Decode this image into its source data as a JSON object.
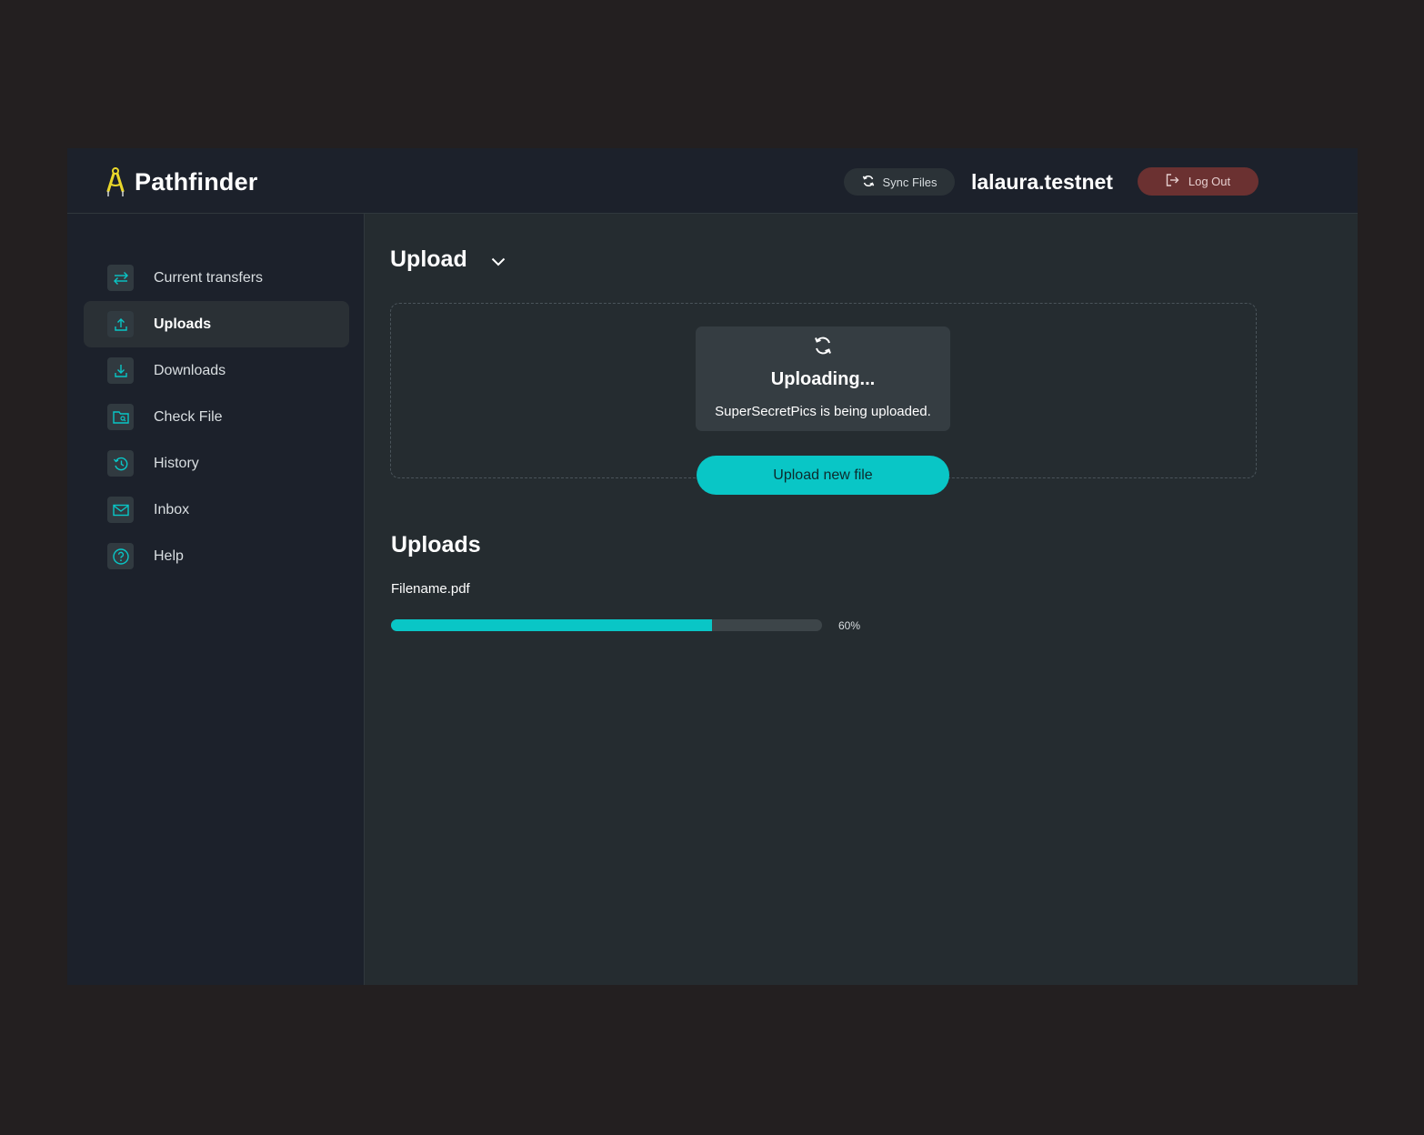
{
  "brand": {
    "name": "Pathfinder",
    "logo_icon": "compass-icon",
    "accent": "#e8d62a"
  },
  "header": {
    "sync_label": "Sync Files",
    "sync_icon": "sync-icon",
    "username": "lalaura.testnet",
    "logout_label": "Log Out",
    "logout_icon": "logout-icon"
  },
  "sidebar": {
    "active": "Uploads",
    "items": [
      {
        "label": "Current transfers",
        "icon": "transfer-arrows-icon"
      },
      {
        "label": "Uploads",
        "icon": "upload-icon"
      },
      {
        "label": "Downloads",
        "icon": "download-icon"
      },
      {
        "label": "Check File",
        "icon": "folder-search-icon"
      },
      {
        "label": "History",
        "icon": "history-icon"
      },
      {
        "label": "Inbox",
        "icon": "mail-icon"
      },
      {
        "label": "Help",
        "icon": "help-icon"
      }
    ]
  },
  "upload_section": {
    "title": "Upload",
    "status_title": "Uploading...",
    "status_message": "SuperSecretPics is being uploaded.",
    "button_label": "Upload new file"
  },
  "uploads_list": {
    "title": "Uploads",
    "items": [
      {
        "file_name": "Filename.pdf",
        "progress": 0.6,
        "progress_label": "60%"
      }
    ]
  },
  "colors": {
    "accent": "#09c6c6",
    "logout": "#6b3131",
    "background": "#231f20",
    "panel": "#252c30",
    "sidebar": "#1c212b"
  }
}
